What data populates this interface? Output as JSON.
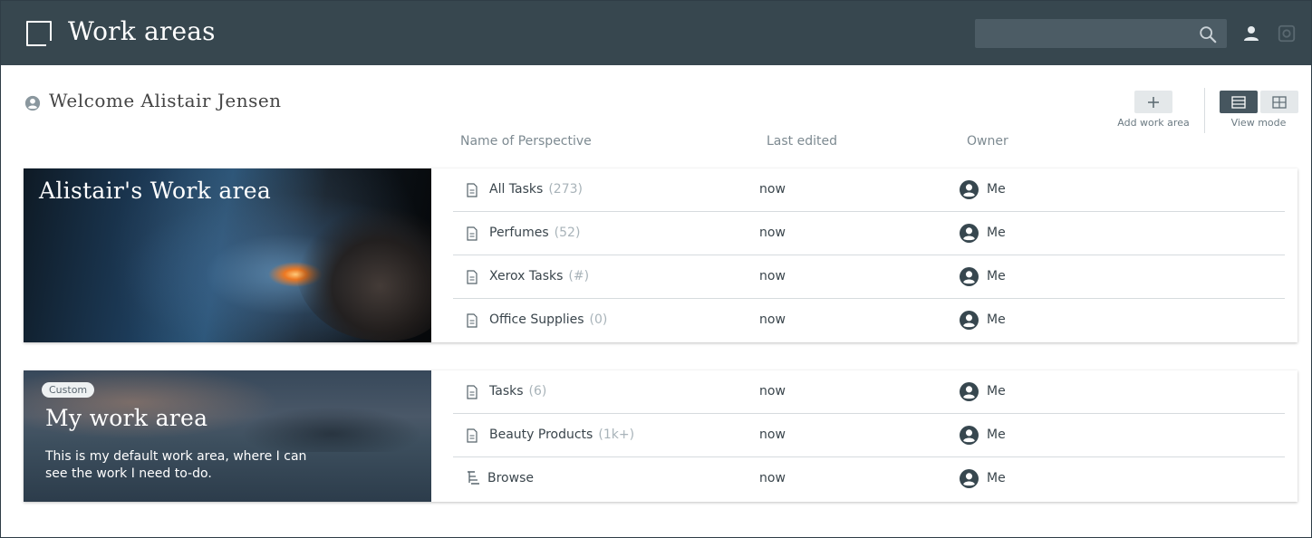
{
  "header": {
    "title": "Work areas",
    "search_placeholder": "",
    "icons": [
      "logo-icon",
      "search-icon",
      "user-icon",
      "gear-icon"
    ]
  },
  "welcome": {
    "text": "Welcome Alistair Jensen"
  },
  "toolbar": {
    "add_label": "Add work area",
    "view_mode_label": "View mode",
    "view_mode_selected": "list"
  },
  "columns": {
    "name": "Name of Perspective",
    "edited": "Last edited",
    "owner": "Owner"
  },
  "work_areas": [
    {
      "title": "Alistair's Work area",
      "badge": "",
      "description": "",
      "perspectives": [
        {
          "name": "All Tasks",
          "count": "(273)",
          "edited": "now",
          "owner": "Me",
          "icon": "document-icon"
        },
        {
          "name": "Perfumes",
          "count": "(52)",
          "edited": "now",
          "owner": "Me",
          "icon": "document-icon"
        },
        {
          "name": "Xerox Tasks",
          "count": "(#)",
          "edited": "now",
          "owner": "Me",
          "icon": "document-icon"
        },
        {
          "name": "Office Supplies",
          "count": "(0)",
          "edited": "now",
          "owner": "Me",
          "icon": "document-icon"
        }
      ]
    },
    {
      "title": "My work area",
      "badge": "Custom",
      "description": "This is my default work area, where I can see the work I need to-do.",
      "perspectives": [
        {
          "name": "Tasks",
          "count": "(6)",
          "edited": "now",
          "owner": "Me",
          "icon": "document-icon"
        },
        {
          "name": "Beauty Products",
          "count": "(1k+)",
          "edited": "now",
          "owner": "Me",
          "icon": "document-icon"
        },
        {
          "name": "Browse",
          "count": "",
          "edited": "now",
          "owner": "Me",
          "icon": "browse-icon"
        }
      ]
    }
  ],
  "colors": {
    "header_bg": "#37474f",
    "count_text": "#a8b3b9",
    "view_selected_bg": "#46565f"
  }
}
